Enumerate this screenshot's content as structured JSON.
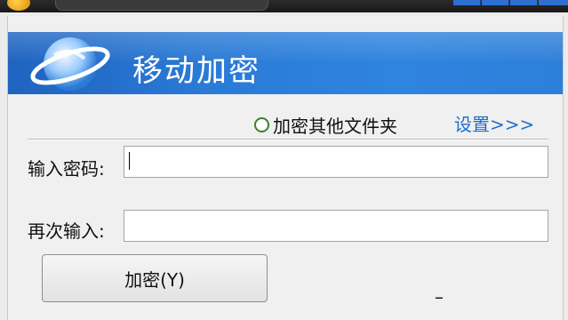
{
  "window": {
    "title": "移动加密"
  },
  "options": {
    "encrypt_other_folder": "加密其他文件夹",
    "settings_link": "设置>>>"
  },
  "form": {
    "password_label": "输入密码:",
    "password_value": "",
    "confirm_label": "再次输入:",
    "confirm_value": ""
  },
  "actions": {
    "encrypt_button": "加密(Y)"
  },
  "status": {
    "dash": "–"
  },
  "colors": {
    "banner_blue": "#2a7ad6",
    "link_blue": "#1f6fd0",
    "radio_green": "#3d7f2a"
  },
  "icons": {
    "banner": "globe-icon",
    "option": "radio-button"
  }
}
